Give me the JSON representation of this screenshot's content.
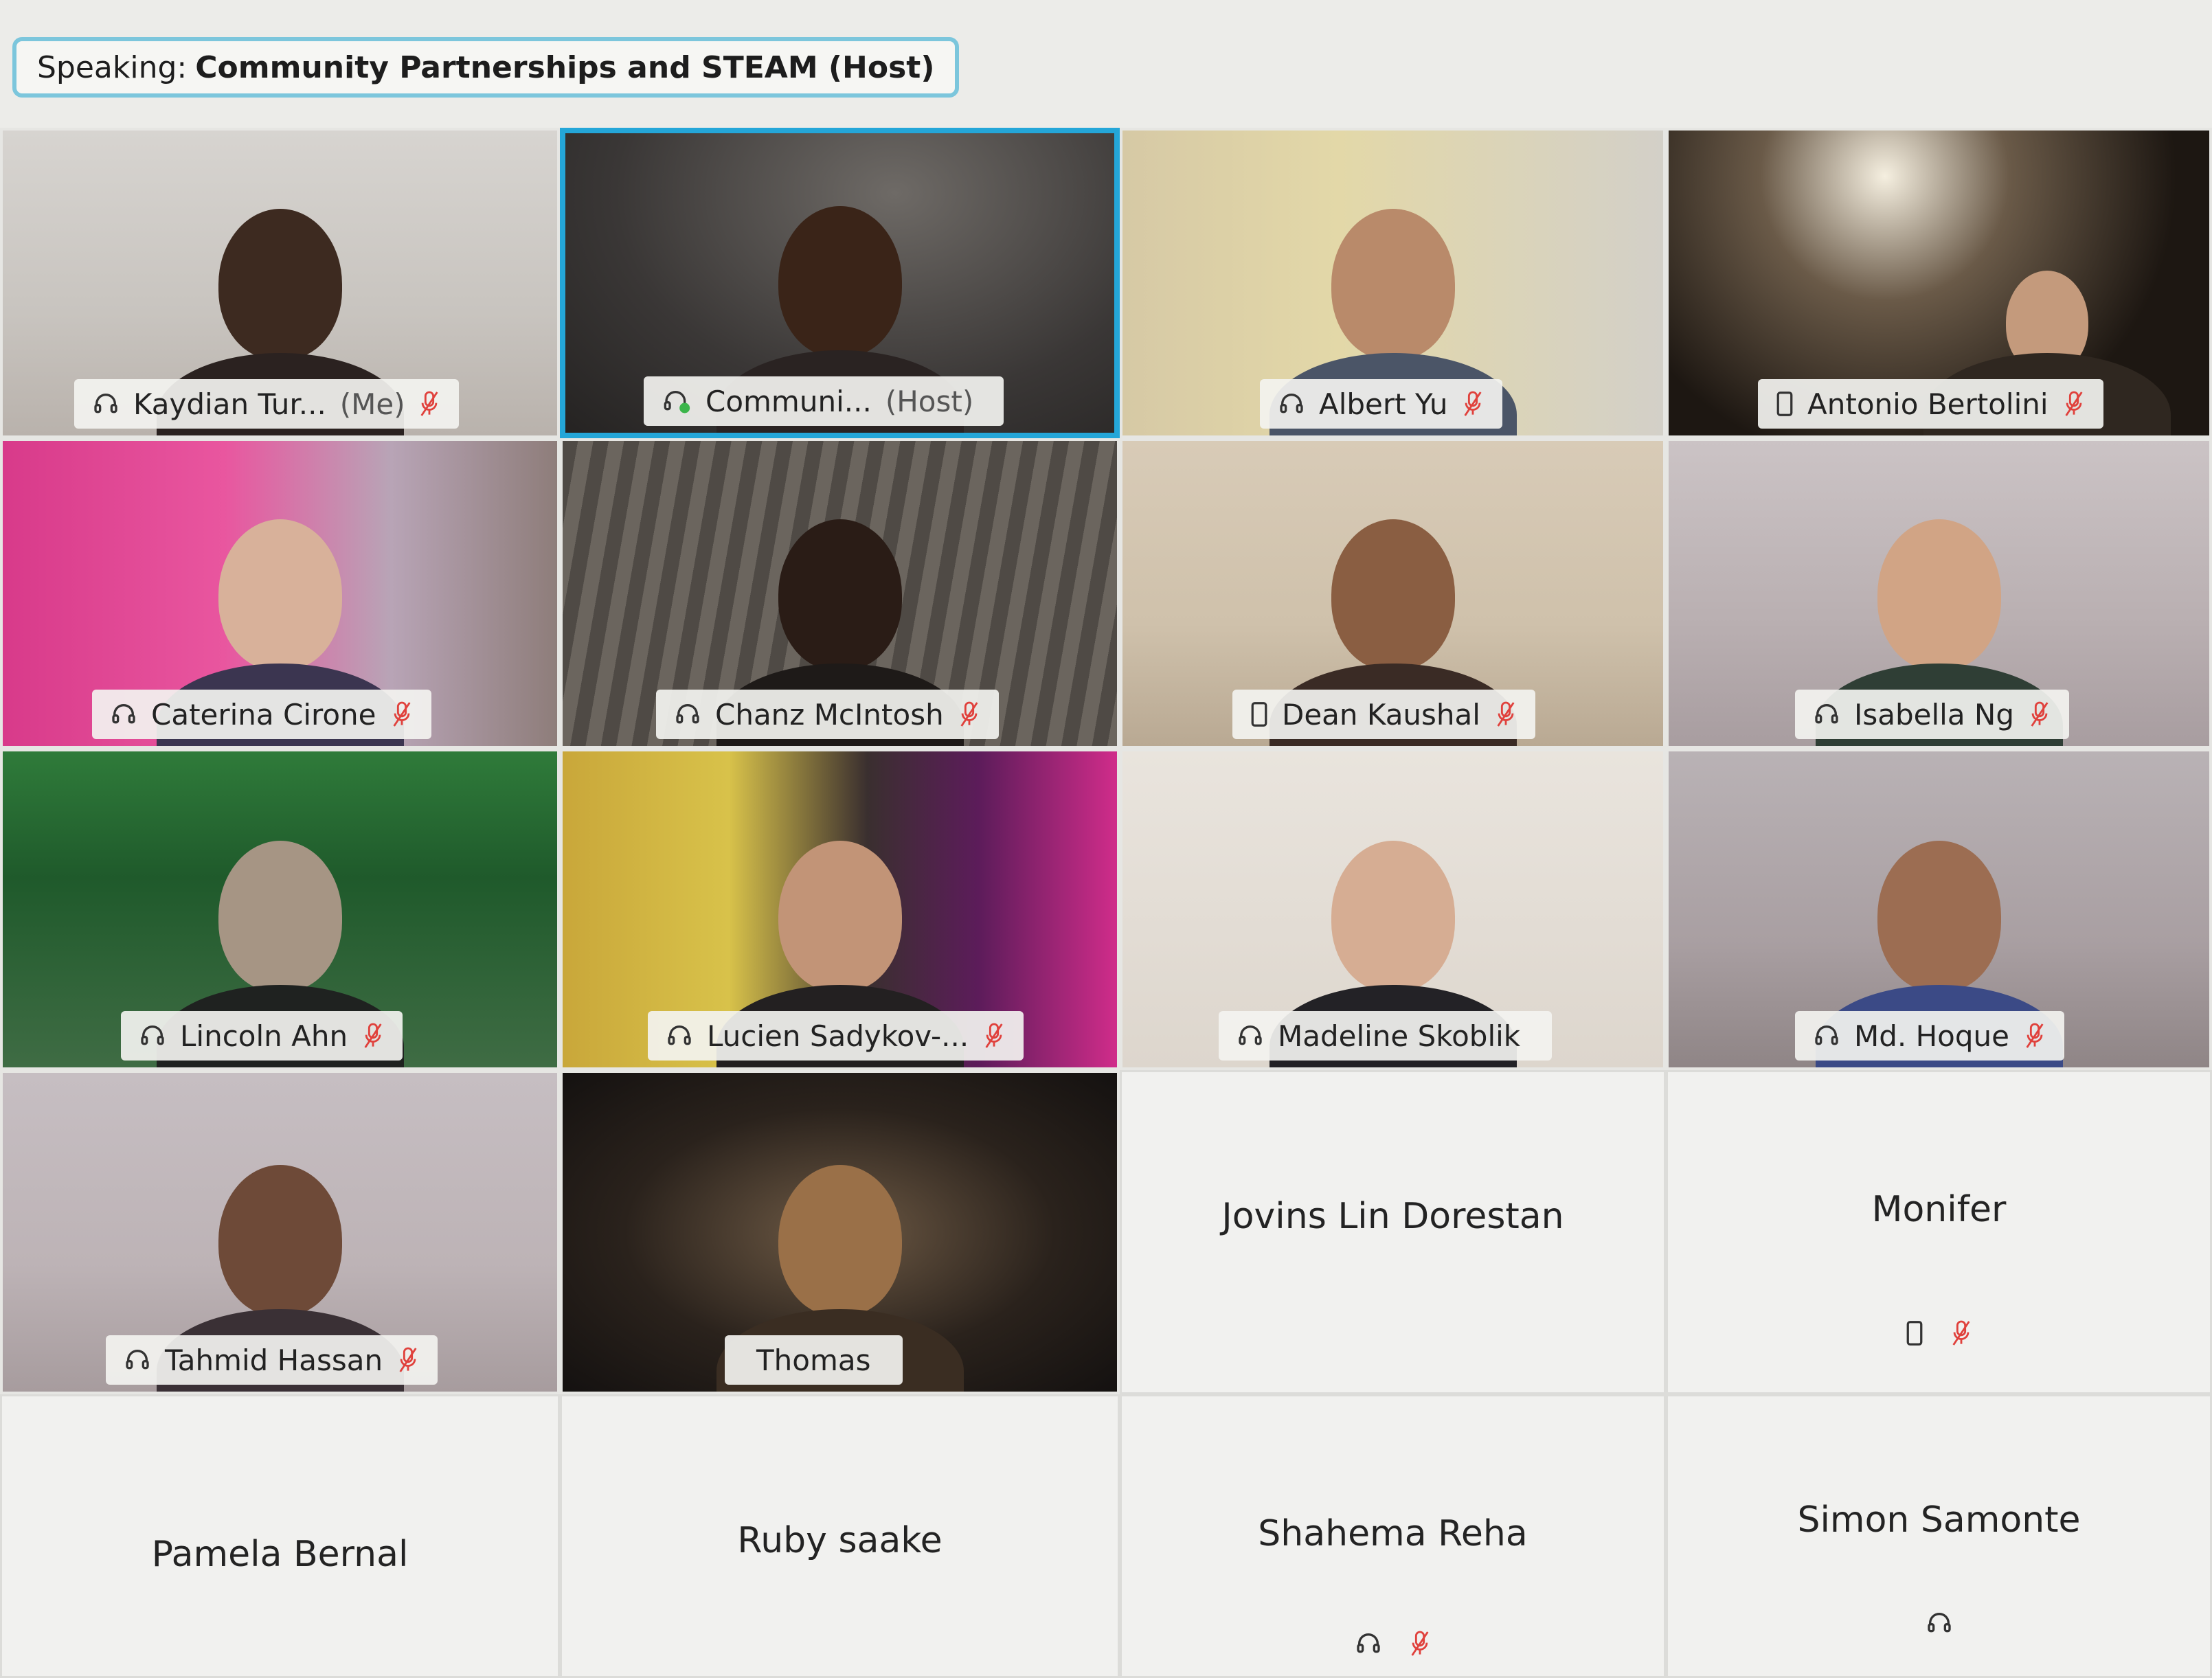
{
  "speaking_bar": {
    "label": "Speaking:",
    "speaker": "Community Partnerships and STEAM (Host)"
  },
  "colors": {
    "active_border": "#24a6d8",
    "speaking_border": "#7cc6dc",
    "mute_icon": "#e0413c"
  },
  "tiles": [
    {
      "name": "Kaydian Tur...",
      "suffix": "(Me)",
      "icon": "headset-icon",
      "muted": true,
      "video": true
    },
    {
      "name": "Communi...",
      "suffix": "(Host)",
      "icon": "call-in-icon",
      "muted": false,
      "video": true,
      "active": true
    },
    {
      "name": "Albert Yu",
      "suffix": "",
      "icon": "headset-icon",
      "muted": true,
      "video": true
    },
    {
      "name": "Antonio Bertolini",
      "suffix": "",
      "icon": "phone-icon",
      "muted": true,
      "video": true
    },
    {
      "name": "Caterina Cirone",
      "suffix": "",
      "icon": "headset-icon",
      "muted": true,
      "video": true
    },
    {
      "name": "Chanz McIntosh",
      "suffix": "",
      "icon": "headset-icon",
      "muted": true,
      "video": true
    },
    {
      "name": "Dean Kaushal",
      "suffix": "",
      "icon": "phone-icon",
      "muted": true,
      "video": true
    },
    {
      "name": "Isabella Ng",
      "suffix": "",
      "icon": "headset-icon",
      "muted": true,
      "video": true
    },
    {
      "name": "Lincoln Ahn",
      "suffix": "",
      "icon": "headset-icon",
      "muted": true,
      "video": true
    },
    {
      "name": "Lucien Sadykov-...",
      "suffix": "",
      "icon": "headset-icon",
      "muted": true,
      "video": true
    },
    {
      "name": "Madeline Skoblik",
      "suffix": "",
      "icon": "headset-icon",
      "muted": false,
      "video": true
    },
    {
      "name": "Md. Hoque",
      "suffix": "",
      "icon": "headset-icon",
      "muted": true,
      "video": true
    },
    {
      "name": "Tahmid Hassan",
      "suffix": "",
      "icon": "headset-icon",
      "muted": true,
      "video": true
    },
    {
      "name": "Thomas",
      "suffix": "",
      "icon": "",
      "muted": false,
      "video": true
    },
    {
      "name": "Jovins Lin Dorestan",
      "video": false,
      "icons": []
    },
    {
      "name": "Monifer",
      "video": false,
      "icons": [
        "phone-icon",
        "mute-icon"
      ]
    },
    {
      "name": "Pamela Bernal",
      "video": false,
      "icons": []
    },
    {
      "name": "Ruby saake",
      "video": false,
      "icons": []
    },
    {
      "name": "Shahema Reha",
      "video": false,
      "icons": [
        "headset-icon",
        "mute-icon"
      ]
    },
    {
      "name": "Simon Samonte",
      "video": false,
      "icons": [
        "headset-icon"
      ]
    }
  ]
}
